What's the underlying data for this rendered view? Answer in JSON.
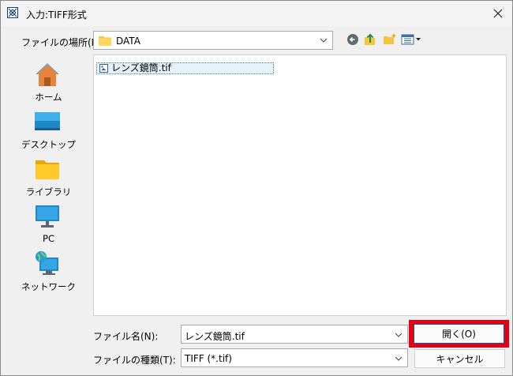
{
  "window": {
    "title": "入力:TIFF形式"
  },
  "lookin": {
    "label": "ファイルの場所(I):",
    "value": "DATA"
  },
  "places": [
    {
      "label": "ホーム",
      "icon": "home-icon"
    },
    {
      "label": "デスクトップ",
      "icon": "desktop-icon"
    },
    {
      "label": "ライブラリ",
      "icon": "library-icon"
    },
    {
      "label": "PC",
      "icon": "pc-icon"
    },
    {
      "label": "ネットワーク",
      "icon": "network-icon"
    }
  ],
  "files": [
    {
      "name": "レンズ鏡筒.tif"
    }
  ],
  "filename": {
    "label": "ファイル名(N):",
    "value": "レンズ鏡筒.tif"
  },
  "filetype": {
    "label": "ファイルの種類(T):",
    "value": "TIFF (*.tif)"
  },
  "buttons": {
    "open": "開く(O)",
    "cancel": "キャンセル"
  },
  "colors": {
    "highlight": "#e60012",
    "accent": "#005fb8"
  }
}
